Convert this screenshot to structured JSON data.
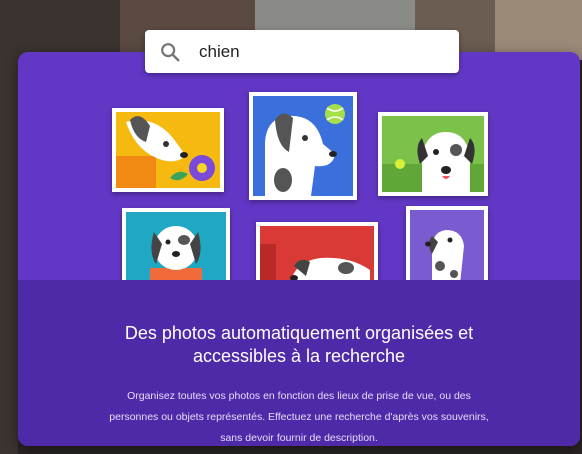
{
  "search": {
    "query": "chien"
  },
  "promo": {
    "headline_line1": "Des photos automatiquement organisées et",
    "headline_line2": "accessibles à la recherche",
    "body_line1": "Organisez toutes vos photos en fonction des lieux de prise de vue, ou des",
    "body_line2": "personnes ou objets représentés. Effectuez une recherche d'après vos souvenirs,",
    "body_line3": "sans devoir fournir de description."
  },
  "colors": {
    "card_purple": "#6337c6",
    "card_bottom_purple": "#4f2aa8",
    "tile_yellow": "#f5b90f",
    "tile_blue": "#3b6fdb",
    "tile_green": "#7cc24a",
    "tile_teal": "#1fa7c4",
    "tile_red": "#d93a35",
    "tile_violet": "#7a5bd0"
  },
  "icons": [
    "search-icon"
  ]
}
